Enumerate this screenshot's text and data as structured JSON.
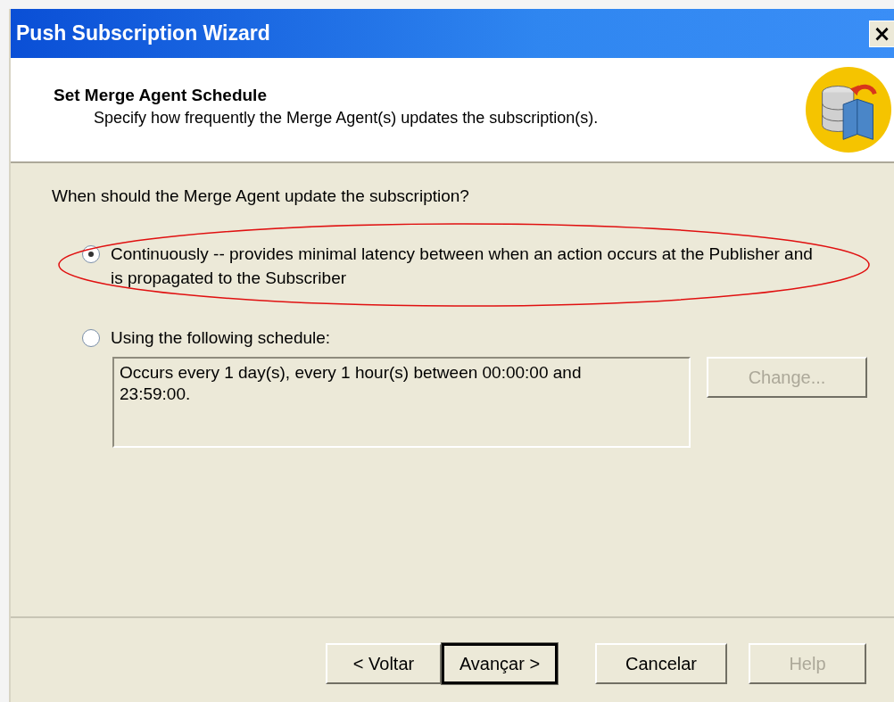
{
  "window": {
    "title": "Push Subscription Wizard",
    "close": "×"
  },
  "header": {
    "title": "Set Merge Agent Schedule",
    "subtitle": "Specify how frequently the Merge Agent(s) updates the subscription(s)."
  },
  "question": "When should the Merge Agent update the subscription?",
  "options": [
    {
      "label": "Continuously -- provides minimal latency between when an action occurs at the Publisher and is propagated to the Subscriber",
      "selected": true,
      "highlighted": true
    },
    {
      "label": "Using the following schedule:",
      "selected": false,
      "highlighted": false
    }
  ],
  "schedule": {
    "description": "Occurs every 1 day(s), every 1 hour(s) between 00:00:00 and 23:59:00.",
    "change_button": {
      "label": "Change...",
      "disabled": true
    }
  },
  "buttons": [
    {
      "label": "< Voltar",
      "disabled": false,
      "default": false
    },
    {
      "label": "Avançar >",
      "disabled": false,
      "default": true
    },
    {
      "label": "Cancelar",
      "disabled": false,
      "default": false
    },
    {
      "label": "Help",
      "disabled": true,
      "default": false
    }
  ]
}
